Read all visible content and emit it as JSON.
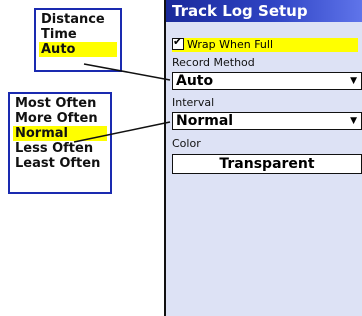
{
  "screen": {
    "title": "Track Log Setup",
    "wrap_checkbox": {
      "label": "Wrap When Full",
      "checked": true,
      "check_glyph": "✔"
    },
    "record_method": {
      "label": "Record Method",
      "value": "Auto"
    },
    "interval": {
      "label": "Interval",
      "value": "Normal"
    },
    "color": {
      "label": "Color",
      "value": "Transparent"
    },
    "dropdown_icon": "chevron-down-icon"
  },
  "popup_record_method": {
    "options": [
      "Distance",
      "Time",
      "Auto"
    ],
    "selected": "Auto"
  },
  "popup_interval": {
    "options": [
      "Most Often",
      "More Often",
      "Normal",
      "Less Often",
      "Least Often"
    ],
    "selected": "Normal"
  },
  "colors": {
    "title_bar": "#2f44c4",
    "highlight": "#ffff00",
    "screen_bg": "#dde2f5",
    "popup_border": "#1a2ab0"
  }
}
